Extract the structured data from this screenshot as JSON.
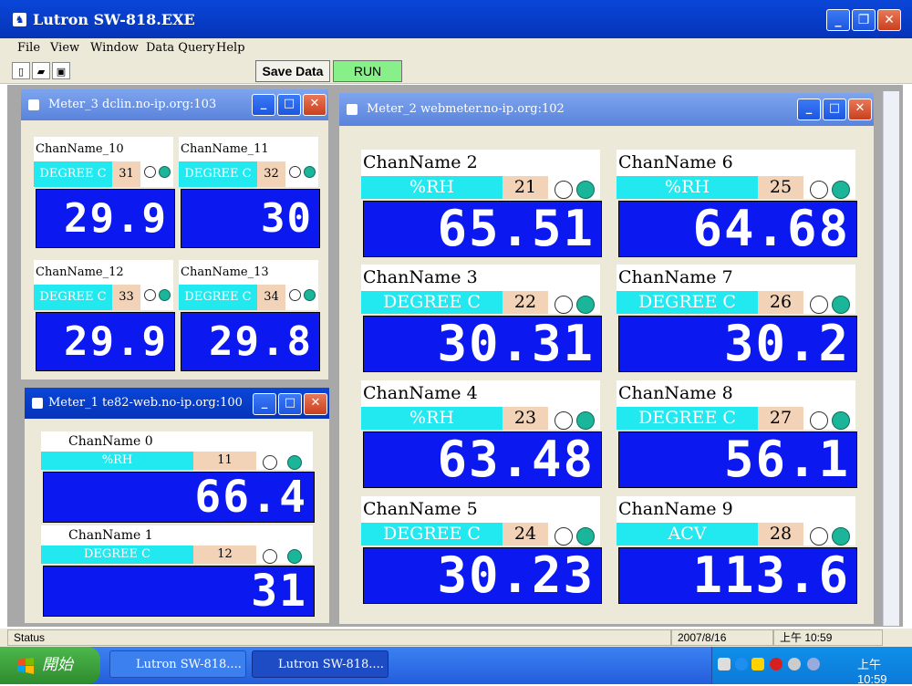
{
  "app": {
    "title": "Lutron SW-818.EXE"
  },
  "menu": [
    "File",
    "View",
    "Window",
    "Data Query",
    "Help"
  ],
  "toolbar": {
    "save_label": "Save Data",
    "run_label": "RUN"
  },
  "windows": {
    "meter3": {
      "title": "Meter_3  dclin.no-ip.org:103",
      "channels": [
        {
          "name": "ChanName_10",
          "unit": "DEGREE C",
          "num": "31",
          "value": "29.9"
        },
        {
          "name": "ChanName_11",
          "unit": "DEGREE C",
          "num": "32",
          "value": "30"
        },
        {
          "name": "ChanName_12",
          "unit": "DEGREE C",
          "num": "33",
          "value": "29.9"
        },
        {
          "name": "ChanName_13",
          "unit": "DEGREE C",
          "num": "34",
          "value": "29.8"
        }
      ]
    },
    "meter1": {
      "title": "Meter_1  te82-web.no-ip.org:100",
      "channels": [
        {
          "name": "ChanName  0",
          "unit": "%RH",
          "num": "11",
          "value": "66.4"
        },
        {
          "name": "ChanName  1",
          "unit": "DEGREE C",
          "num": "12",
          "value": "31"
        }
      ]
    },
    "meter2": {
      "title": "Meter_2  webmeter.no-ip.org:102",
      "channels": [
        {
          "name": "ChanName  2",
          "unit": "%RH",
          "num": "21",
          "value": "65.51"
        },
        {
          "name": "ChanName  6",
          "unit": "%RH",
          "num": "25",
          "value": "64.68"
        },
        {
          "name": "ChanName  3",
          "unit": "DEGREE C",
          "num": "22",
          "value": "30.31"
        },
        {
          "name": "ChanName  7",
          "unit": "DEGREE C",
          "num": "26",
          "value": "30.2"
        },
        {
          "name": "ChanName  4",
          "unit": "%RH",
          "num": "23",
          "value": "63.48"
        },
        {
          "name": "ChanName  8",
          "unit": "DEGREE C",
          "num": "27",
          "value": "56.1"
        },
        {
          "name": "ChanName  5",
          "unit": "DEGREE C",
          "num": "24",
          "value": "30.23"
        },
        {
          "name": "ChanName  9",
          "unit": "ACV",
          "num": "28",
          "value": "113.6"
        }
      ]
    }
  },
  "status": {
    "text": "Status",
    "date": "2007/8/16",
    "time": "上午 10:59"
  },
  "taskbar": {
    "start_label": "開始",
    "tasks": [
      "Lutron SW-818....",
      "Lutron SW-818...."
    ],
    "clock": "上午 10:59"
  },
  "colors": {
    "display_blue": "#0b18f0",
    "unit_cyan": "#22e8f0",
    "num_peach": "#f3d3b8",
    "led_on": "#1bb59a",
    "run_green": "#88f088"
  },
  "icons": [
    "app-icon",
    "new-file-icon",
    "open-folder-icon",
    "save-disk-icon",
    "minimize-icon",
    "maximize-icon",
    "close-icon",
    "windows-flag-icon"
  ]
}
